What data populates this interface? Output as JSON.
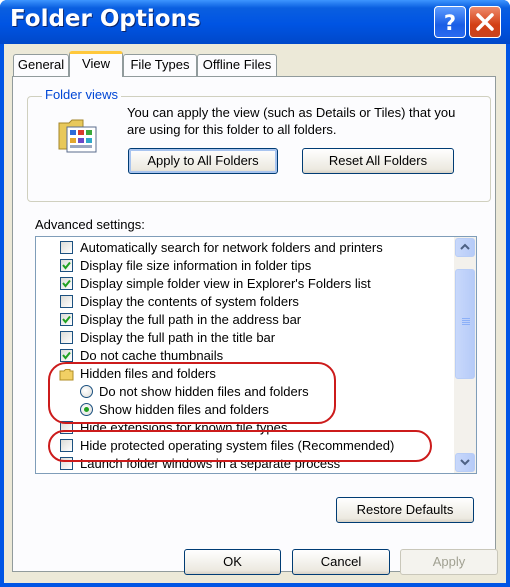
{
  "window": {
    "title": "Folder Options"
  },
  "tabs": [
    {
      "label": "General",
      "active": false
    },
    {
      "label": "View",
      "active": true
    },
    {
      "label": "File Types",
      "active": false
    },
    {
      "label": "Offline Files",
      "active": false
    }
  ],
  "folder_views": {
    "title": "Folder views",
    "description": "You can apply the view (such as Details or Tiles) that you are using for this folder to all folders.",
    "apply_button": "Apply to All Folders",
    "reset_button": "Reset All Folders"
  },
  "advanced": {
    "label": "Advanced settings:",
    "items": [
      {
        "type": "checkbox",
        "label": "Automatically search for network folders and printers",
        "checked": false
      },
      {
        "type": "checkbox",
        "label": "Display file size information in folder tips",
        "checked": true
      },
      {
        "type": "checkbox",
        "label": "Display simple folder view in Explorer's Folders list",
        "checked": true
      },
      {
        "type": "checkbox",
        "label": "Display the contents of system folders",
        "checked": false
      },
      {
        "type": "checkbox",
        "label": "Display the full path in the address bar",
        "checked": true
      },
      {
        "type": "checkbox",
        "label": "Display the full path in the title bar",
        "checked": false
      },
      {
        "type": "checkbox",
        "label": "Do not cache thumbnails",
        "checked": true
      },
      {
        "type": "folder",
        "label": "Hidden files and folders"
      },
      {
        "type": "radio",
        "label": "Do not show hidden files and folders",
        "checked": false
      },
      {
        "type": "radio",
        "label": "Show hidden files and folders",
        "checked": true
      },
      {
        "type": "checkbox",
        "label": "Hide extensions for known file types",
        "checked": false
      },
      {
        "type": "checkbox",
        "label": "Hide protected operating system files (Recommended)",
        "checked": false
      },
      {
        "type": "checkbox",
        "label": "Launch folder windows in a separate process",
        "checked": false
      }
    ]
  },
  "buttons": {
    "restore_defaults": "Restore Defaults",
    "ok": "OK",
    "cancel": "Cancel",
    "apply": "Apply"
  },
  "colors": {
    "titlebar": "#0054e3",
    "check": "#21a121",
    "annotation": "#cc1b1b",
    "group_title": "#0046d5"
  }
}
